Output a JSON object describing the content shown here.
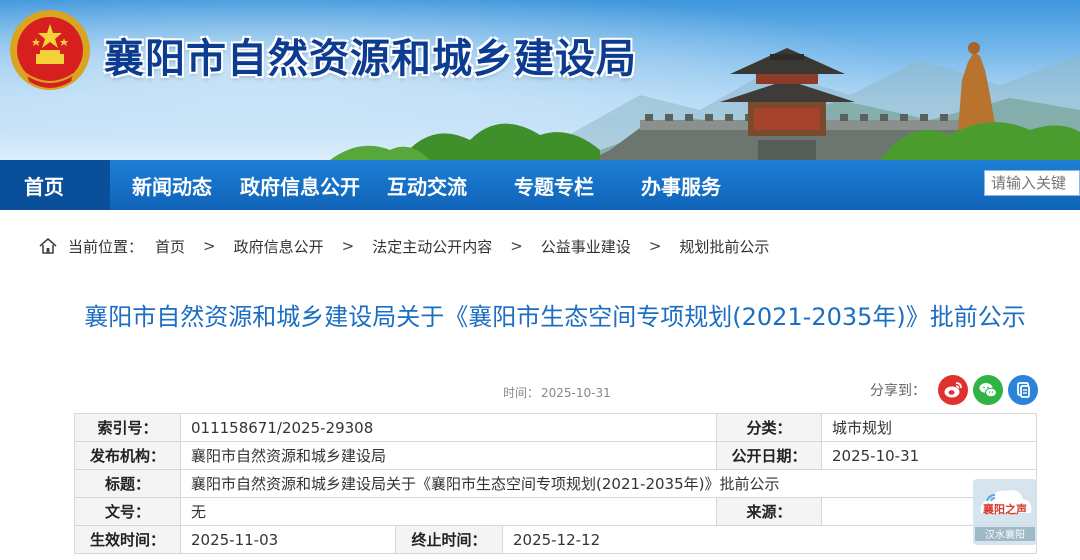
{
  "header": {
    "site_title": "襄阳市自然资源和城乡建设局"
  },
  "nav": {
    "home": "首页",
    "items": [
      "新闻动态",
      "政府信息公开",
      "互动交流",
      "专题专栏",
      "办事服务"
    ],
    "search_placeholder": "请输入关键"
  },
  "breadcrumb": {
    "label": "当前位置：",
    "items": [
      "首页",
      "政府信息公开",
      "法定主动公开内容",
      "公益事业建设",
      "规划批前公示"
    ],
    "separator": ">"
  },
  "article": {
    "title": "襄阳市自然资源和城乡建设局关于《襄阳市生态空间专项规划(2021-2035年)》批前公示",
    "time_label": "时间：",
    "time": "2025-10-31",
    "share_label": "分享到："
  },
  "info": {
    "index_label": "索引号：",
    "index_value": "011158671/2025-29308",
    "category_label": "分类：",
    "category_value": "城市规划",
    "publisher_label": "发布机构：",
    "publisher_value": "襄阳市自然资源和城乡建设局",
    "pubdate_label": "公开日期：",
    "pubdate_value": "2025-10-31",
    "subject_label": "标题：",
    "subject_value": "襄阳市自然资源和城乡建设局关于《襄阳市生态空间专项规划(2021-2035年)》批前公示",
    "docno_label": "文号：",
    "docno_value": "无",
    "source_label": "来源：",
    "source_value": "",
    "effective_label": "生效时间：",
    "effective_value": "2025-11-03",
    "end_label": "终止时间：",
    "end_value": "2025-12-12"
  },
  "watermark": {
    "line1": "襄阳之声",
    "line2": "汉水襄阳"
  },
  "colors": {
    "nav_bg": "#1370c4",
    "nav_home_bg": "#0a4f9a",
    "title_blue": "#1b6ec2",
    "site_title": "#0b3c91",
    "weibo": "#e0312f",
    "wechat": "#2fb443",
    "other_share": "#2c83da"
  },
  "icons": [
    "national-emblem-icon",
    "home-icon",
    "weibo-icon",
    "wechat-icon",
    "share-copy-icon"
  ]
}
